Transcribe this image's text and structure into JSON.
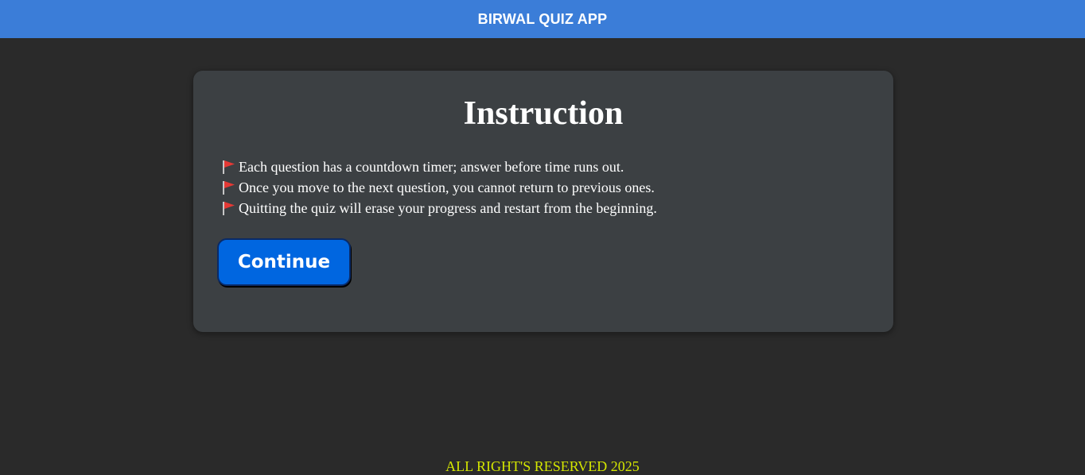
{
  "header": {
    "title": "BIRWAL QUIZ APP"
  },
  "card": {
    "title": "Instruction",
    "rules": [
      "Each question has a countdown timer; answer before time runs out.",
      "Once you move to the next question, you cannot return to previous ones.",
      "Quitting the quiz will erase your progress and restart from the beginning."
    ],
    "rule_icon": "red-flag-icon",
    "continue_label": "Continue"
  },
  "footer": {
    "text": "ALL RIGHT'S RESERVED 2025"
  },
  "colors": {
    "header_bg": "#3b7dd8",
    "page_bg": "#2a2a2a",
    "card_bg": "#3c4043",
    "button_bg": "#0066e0",
    "footer_text": "#d4e600",
    "flag": "#e53935"
  }
}
